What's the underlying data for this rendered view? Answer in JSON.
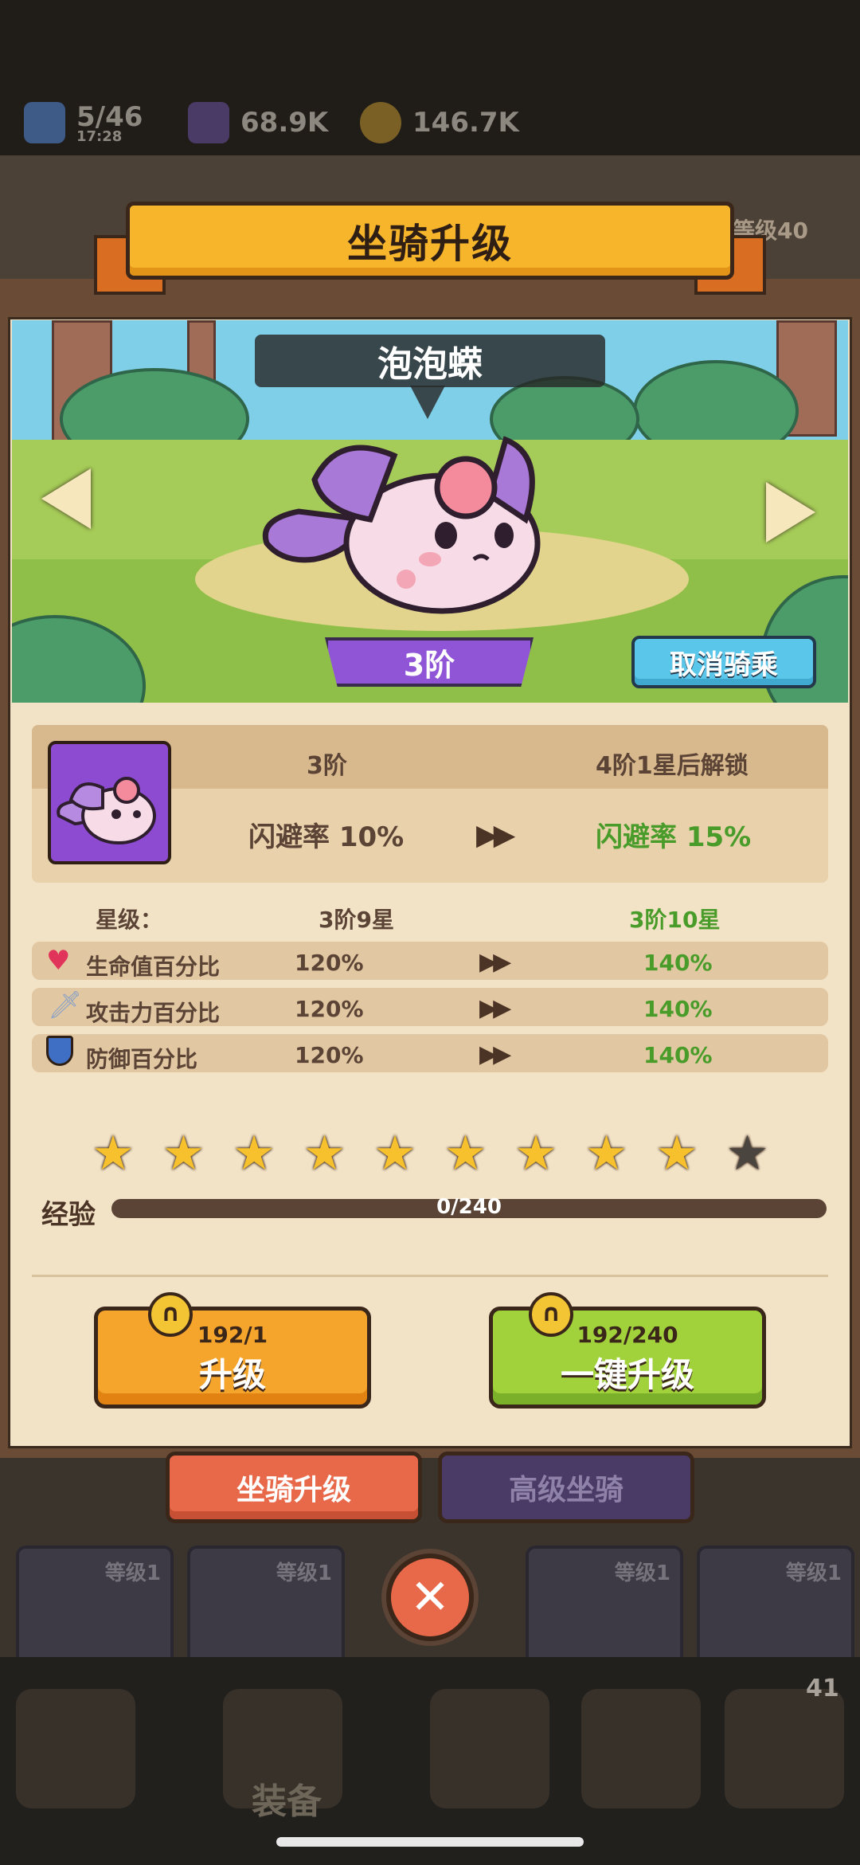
{
  "resources": {
    "energy": "5/46",
    "energy_timer": "17:28",
    "gems": "68.9K",
    "coins": "146.7K"
  },
  "background": {
    "level_right": "等级40",
    "slots": [
      "等级1",
      "等级1",
      "等级1",
      "等级1",
      "等级1"
    ],
    "nav_label": "装备",
    "nav_badge": "41"
  },
  "title": "坐骑升级",
  "mount": {
    "name": "泡泡蝾",
    "tier": "3阶",
    "cancel_ride": "取消骑乘"
  },
  "compare": {
    "current_tier": "3阶",
    "next_unlock": "4阶1星后解锁",
    "current_effect": "闪避率 10%",
    "next_effect": "闪避率 15%"
  },
  "star_level": {
    "label": "星级：",
    "current": "3阶9星",
    "next": "3阶10星"
  },
  "stats": [
    {
      "icon": "heart-icon",
      "name": "生命值百分比",
      "current": "120%",
      "next": "140%"
    },
    {
      "icon": "sword-icon",
      "name": "攻击力百分比",
      "current": "120%",
      "next": "140%"
    },
    {
      "icon": "shield-icon",
      "name": "防御百分比",
      "current": "120%",
      "next": "140%"
    }
  ],
  "stars": {
    "filled": 9,
    "total": 10
  },
  "exp": {
    "label": "经验",
    "value": "0/240",
    "progress": 0
  },
  "buttons": {
    "upgrade": {
      "cost": "192/1",
      "label": "升级"
    },
    "one_click": {
      "cost": "192/240",
      "label": "一键升级"
    }
  },
  "tabs": {
    "upgrade": "坐骑升级",
    "advanced": "高级坐骑"
  },
  "colors": {
    "accent_orange": "#f6a52c",
    "accent_green": "#a1d23c",
    "panel": "#f2e2c6",
    "tab_active": "#e8694a",
    "stat_green": "#4a9c2a"
  }
}
